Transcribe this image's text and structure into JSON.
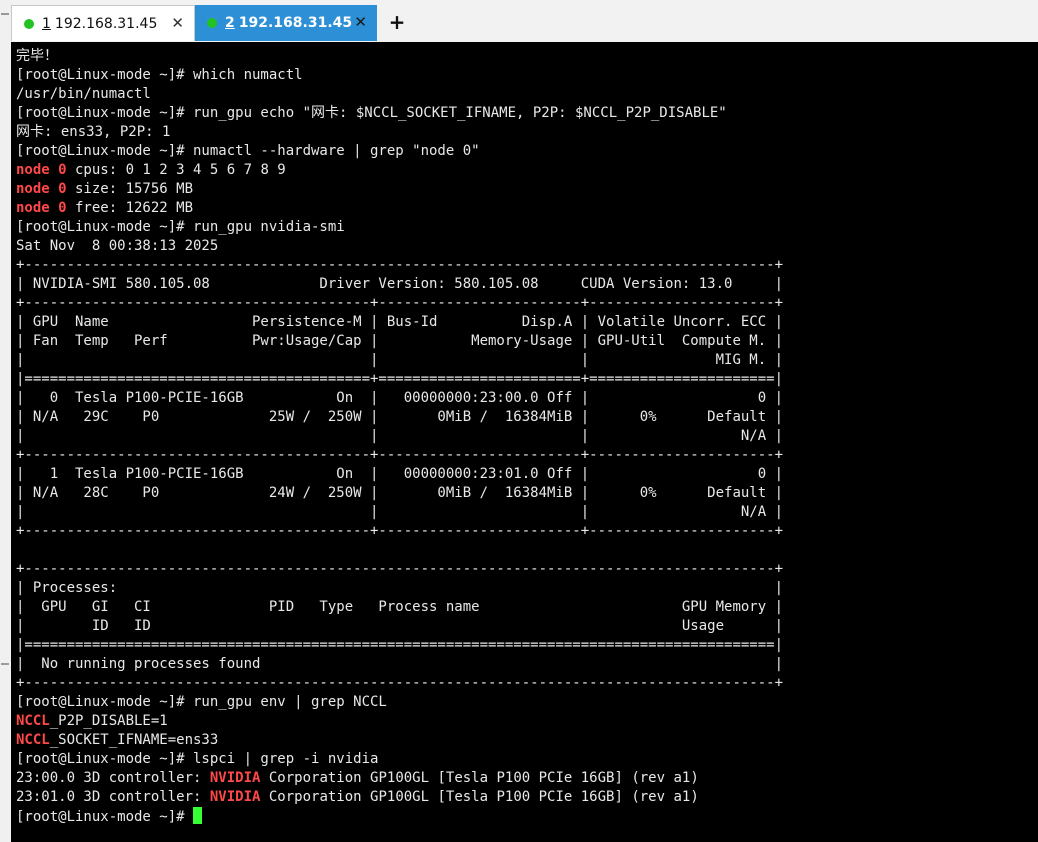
{
  "tabs": [
    {
      "num": "1",
      "host": " 192.168.31.45",
      "close": "✕",
      "active": false
    },
    {
      "num": "2",
      "host": " 192.168.31.45",
      "close": "✕",
      "active": true
    }
  ],
  "new_tab_label": "+",
  "colors": {
    "terminal_bg": "#000000",
    "text": "#e8e8e8",
    "highlight": "#ff4848",
    "cursor": "#33ff33",
    "active_tab": "#2d8fd6",
    "status_dot": "#22c222"
  },
  "terminal": {
    "lines": [
      [
        {
          "t": "完毕！"
        }
      ],
      [
        {
          "t": "[root@Linux-mode ~]# which numactl"
        }
      ],
      [
        {
          "t": "/usr/bin/numactl"
        }
      ],
      [
        {
          "t": "[root@Linux-mode ~]# run_gpu echo \"网卡: $NCCL_SOCKET_IFNAME, P2P: $NCCL_P2P_DISABLE\""
        }
      ],
      [
        {
          "t": "网卡: ens33, P2P: 1"
        }
      ],
      [
        {
          "t": "[root@Linux-mode ~]# numactl --hardware | grep \"node 0\""
        }
      ],
      [
        {
          "t": "node 0",
          "hl": true
        },
        {
          "t": " cpus: 0 1 2 3 4 5 6 7 8 9"
        }
      ],
      [
        {
          "t": "node 0",
          "hl": true
        },
        {
          "t": " size: 15756 MB"
        }
      ],
      [
        {
          "t": "node 0",
          "hl": true
        },
        {
          "t": " free: 12622 MB"
        }
      ],
      [
        {
          "t": "[root@Linux-mode ~]# run_gpu nvidia-smi"
        }
      ],
      [
        {
          "t": "Sat Nov  8 00:38:13 2025"
        }
      ],
      [
        {
          "t": "+-----------------------------------------------------------------------------------------+"
        }
      ],
      [
        {
          "t": "| NVIDIA-SMI 580.105.08             Driver Version: 580.105.08     CUDA Version: 13.0     |"
        }
      ],
      [
        {
          "t": "+-----------------------------------------+------------------------+----------------------+"
        }
      ],
      [
        {
          "t": "| GPU  Name                 Persistence-M | Bus-Id          Disp.A | Volatile Uncorr. ECC |"
        }
      ],
      [
        {
          "t": "| Fan  Temp   Perf          Pwr:Usage/Cap |           Memory-Usage | GPU-Util  Compute M. |"
        }
      ],
      [
        {
          "t": "|                                         |                        |               MIG M. |"
        }
      ],
      [
        {
          "t": "|=========================================+========================+======================|"
        }
      ],
      [
        {
          "t": "|   0  Tesla P100-PCIE-16GB           On  |   00000000:23:00.0 Off |                    0 |"
        }
      ],
      [
        {
          "t": "| N/A   29C    P0             25W /  250W |       0MiB /  16384MiB |      0%      Default |"
        }
      ],
      [
        {
          "t": "|                                         |                        |                  N/A |"
        }
      ],
      [
        {
          "t": "+-----------------------------------------+------------------------+----------------------+"
        }
      ],
      [
        {
          "t": "|   1  Tesla P100-PCIE-16GB           On  |   00000000:23:01.0 Off |                    0 |"
        }
      ],
      [
        {
          "t": "| N/A   28C    P0             24W /  250W |       0MiB /  16384MiB |      0%      Default |"
        }
      ],
      [
        {
          "t": "|                                         |                        |                  N/A |"
        }
      ],
      [
        {
          "t": "+-----------------------------------------+------------------------+----------------------+"
        }
      ],
      [
        {
          "t": ""
        }
      ],
      [
        {
          "t": "+-----------------------------------------------------------------------------------------+"
        }
      ],
      [
        {
          "t": "| Processes:                                                                              |"
        }
      ],
      [
        {
          "t": "|  GPU   GI   CI              PID   Type   Process name                        GPU Memory |"
        }
      ],
      [
        {
          "t": "|        ID   ID                                                               Usage      |"
        }
      ],
      [
        {
          "t": "|=========================================================================================|"
        }
      ],
      [
        {
          "t": "|  No running processes found                                                             |"
        }
      ],
      [
        {
          "t": "+-----------------------------------------------------------------------------------------+"
        }
      ],
      [
        {
          "t": "[root@Linux-mode ~]# run_gpu env | grep NCCL"
        }
      ],
      [
        {
          "t": "NCCL",
          "hl": true
        },
        {
          "t": "_P2P_DISABLE=1"
        }
      ],
      [
        {
          "t": "NCCL",
          "hl": true
        },
        {
          "t": "_SOCKET_IFNAME=ens33"
        }
      ],
      [
        {
          "t": "[root@Linux-mode ~]# lspci | grep -i nvidia"
        }
      ],
      [
        {
          "t": "23:00.0 3D controller: "
        },
        {
          "t": "NVIDIA",
          "hl": true
        },
        {
          "t": " Corporation GP100GL [Tesla P100 PCIe 16GB] (rev a1)"
        }
      ],
      [
        {
          "t": "23:01.0 3D controller: "
        },
        {
          "t": "NVIDIA",
          "hl": true
        },
        {
          "t": " Corporation GP100GL [Tesla P100 PCIe 16GB] (rev a1)"
        }
      ],
      [
        {
          "t": "[root@Linux-mode ~]# "
        },
        {
          "cursor": true
        }
      ]
    ]
  }
}
